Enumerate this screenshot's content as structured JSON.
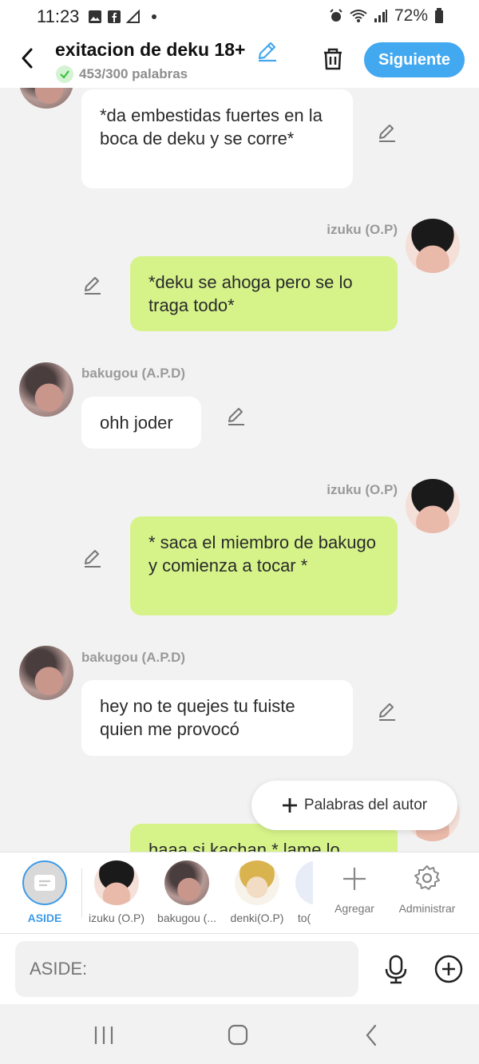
{
  "status": {
    "time": "11:23",
    "battery": "72%"
  },
  "header": {
    "title": "exitacion de deku 18+",
    "word_count": "453/300 palabras",
    "next_label": "Siguiente"
  },
  "messages": [
    {
      "speaker": "bakugou (A.P.D)",
      "side": "left",
      "text": "*da embestidas fuertes en la boca de deku y se corre*"
    },
    {
      "speaker": "izuku (O.P)",
      "side": "right",
      "text": "*deku se ahoga pero se lo traga todo*"
    },
    {
      "speaker": "bakugou (A.P.D)",
      "side": "left",
      "text": "ohh joder"
    },
    {
      "speaker": "izuku (O.P)",
      "side": "right",
      "text": "* saca el miembro de bakugo y comienza a tocar *"
    },
    {
      "speaker": "bakugou (A.P.D)",
      "side": "left",
      "text": "hey no te quejes tu fuiste quien me provocó"
    },
    {
      "speaker": "izuku (O.P)",
      "side": "right",
      "text": "haaa si kachan * lame lo"
    }
  ],
  "author_words_label": "Palabras del autor",
  "characters": [
    {
      "label": "ASIDE",
      "active": true
    },
    {
      "label": "izuku (O.P)"
    },
    {
      "label": "bakugou (..."
    },
    {
      "label": "denki(O.P)"
    },
    {
      "label": "to("
    }
  ],
  "tools": {
    "add_label": "Agregar",
    "manage_label": "Administrar"
  },
  "input": {
    "placeholder": "ASIDE:"
  },
  "colors": {
    "accent": "#42a8f0",
    "bubble_green": "#d6f38a",
    "bubble_white": "#ffffff"
  }
}
